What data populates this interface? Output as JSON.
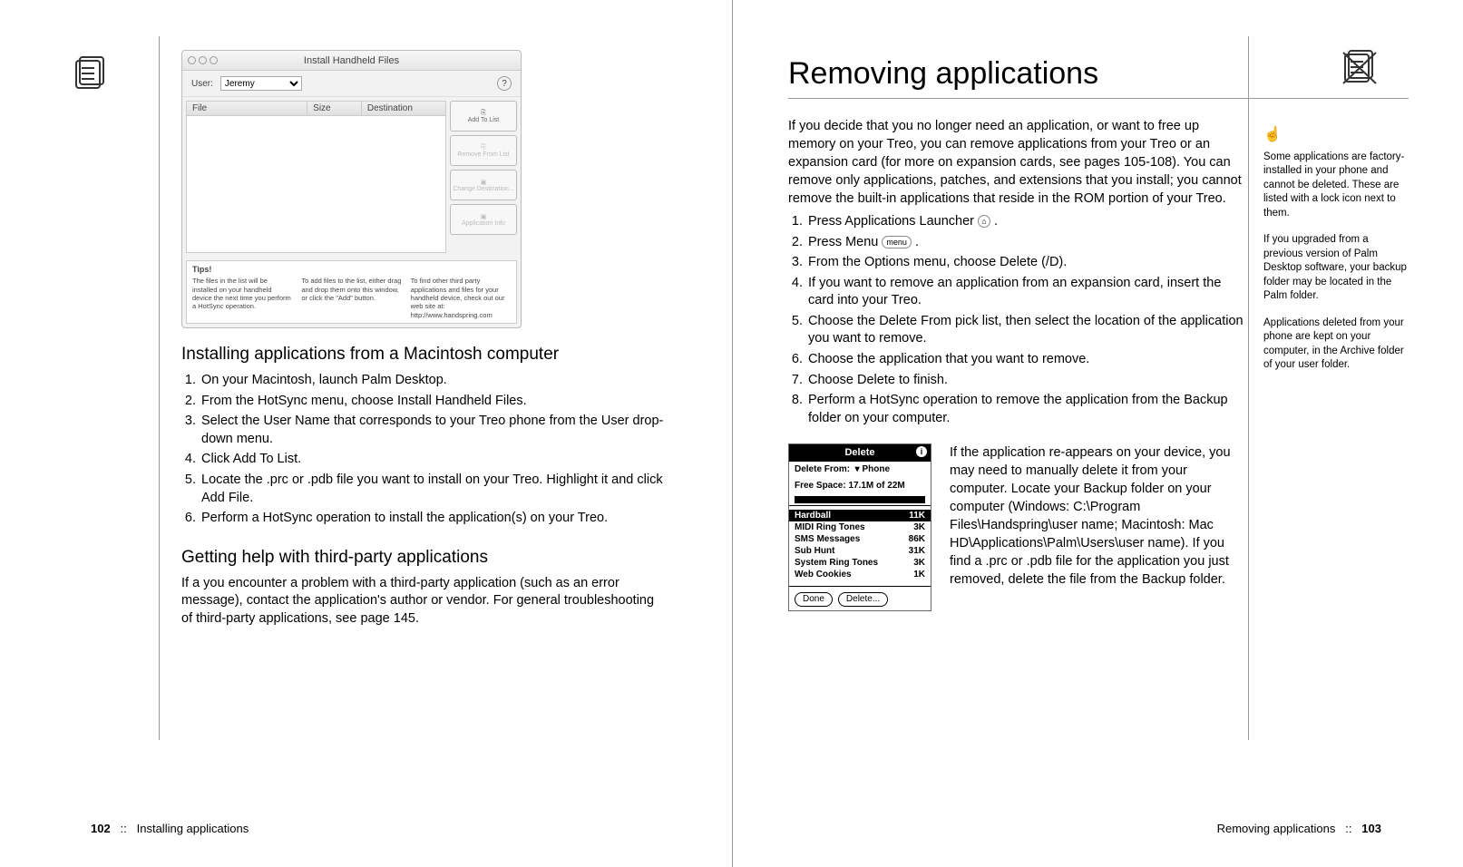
{
  "left": {
    "install_screenshot": {
      "title": "Install Handheld Files",
      "user_label": "User:",
      "user_value": "Jeremy",
      "help_glyph": "?",
      "columns": {
        "file": "File",
        "size": "Size",
        "dest": "Destination"
      },
      "buttons": {
        "add": "Add To List",
        "remove": "Remove From List",
        "change": "Change Destination...",
        "info": "Application Info"
      },
      "tips_title": "Tips!",
      "tip1": "The files in the list will be installed on your handheld device the next time you perform a HotSync operation.",
      "tip2": "To add files to the list, either drag and drop them onto this window, or click the \"Add\" button.",
      "tip3": "To find other third party applications and files for your handheld device, check out our web site at: http://www.handspring.com"
    },
    "h_install": "Installing applications from a Macintosh computer",
    "steps_install": [
      "On your Macintosh, launch Palm Desktop.",
      "From the HotSync menu, choose Install Handheld Files.",
      "Select the User Name that corresponds to your Treo phone from the User drop-down menu.",
      "Click Add To List.",
      "Locate the .prc or .pdb file you want to install on your Treo. Highlight it and click Add File.",
      "Perform a HotSync operation to install the application(s) on your Treo."
    ],
    "h_help": "Getting help with third-party applications",
    "help_body": "If a you encounter a problem with a third-party application (such as an error message), contact the application's author or vendor. For general troubleshooting of third-party applications, see page 145.",
    "footer_page": "102",
    "footer_sep": "::",
    "footer_label": "Installing applications"
  },
  "right": {
    "title": "Removing applications",
    "intro": "If you decide that you no longer need an application, or want to free up memory on your Treo, you can remove applications from your Treo or an expansion card (for more on expansion cards, see pages 105-108). You can remove only applications, patches, and extensions that you install; you cannot remove the built-in applications that reside in the ROM portion of your Treo.",
    "steps": [
      "Press Applications Launcher",
      "Press Menu",
      "From the Options menu, choose Delete (/D).",
      "If you want to remove an application from an expansion card, insert the card into your Treo.",
      "Choose the Delete From pick list, then select the location of the application you want to remove.",
      "Choose the application that you want to remove.",
      "Choose Delete to finish.",
      "Perform a HotSync operation to remove the application from the Backup folder on your computer."
    ],
    "icon_launcher_glyph": "⌂",
    "icon_menu_label": "menu",
    "delete_shot": {
      "title": "Delete",
      "info_glyph": "i",
      "from_label": "Delete From:",
      "from_value": "Phone",
      "free_label": "Free Space: 17.1M of 22M",
      "items": [
        {
          "name": "Hardball",
          "size": "11K",
          "sel": true
        },
        {
          "name": "MIDI Ring Tones",
          "size": "3K"
        },
        {
          "name": "SMS Messages",
          "size": "86K"
        },
        {
          "name": "Sub Hunt",
          "size": "31K"
        },
        {
          "name": "System Ring Tones",
          "size": "3K"
        },
        {
          "name": "Web Cookies",
          "size": "1K"
        }
      ],
      "done": "Done",
      "delete": "Delete..."
    },
    "reappear": "If the application re-appears on your device, you may need to manually delete it from your computer. Locate your Backup folder on your computer (Windows: C:\\Program Files\\Handspring\\user name; Macintosh: Mac HD\\Applications\\Palm\\Users\\user name). If you find a .prc or .pdb file for the application you just removed, delete the file from the Backup folder.",
    "sidebar": {
      "hand_glyph": "☝",
      "n1": "Some applications are factory-installed in your phone and cannot be deleted. These are listed with a lock icon next to them.",
      "n2": "If you upgraded from a previous version of Palm Desktop software, your backup folder may be located in the Palm folder.",
      "n3": "Applications deleted from your phone are kept on your computer, in the Archive folder of your user folder."
    },
    "footer_label": "Removing applications",
    "footer_sep": "::",
    "footer_page": "103"
  }
}
